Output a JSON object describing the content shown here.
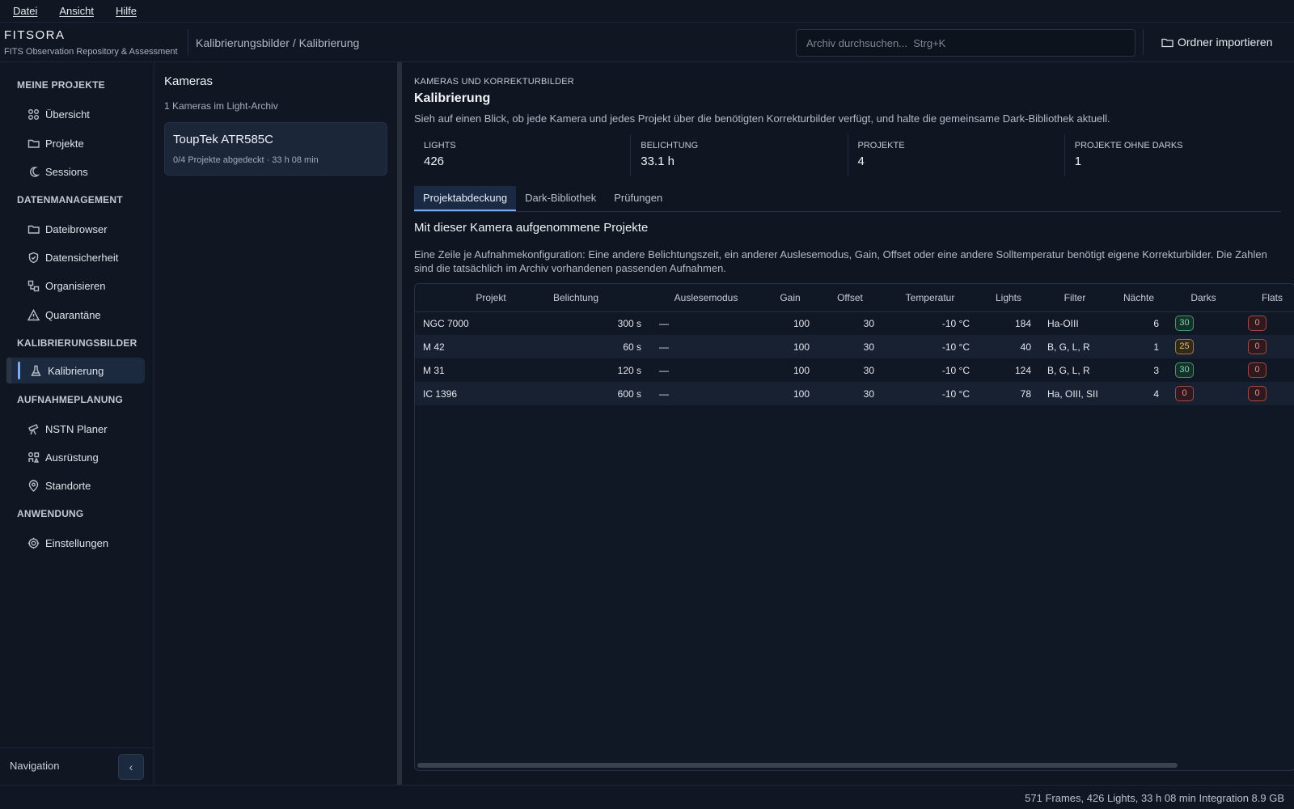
{
  "menu": [
    "Datei",
    "Ansicht",
    "Hilfe"
  ],
  "brand": {
    "title": "FITSORA",
    "subtitle": "FITS Observation Repository & Assessment"
  },
  "breadcrumb": "Kalibrierungsbilder / Kalibrierung",
  "search": {
    "placeholder": "Archiv durchsuchen...  Strg+K",
    "value": ""
  },
  "import_button": "Ordner importieren",
  "sidebar": {
    "sections": [
      {
        "title": "MEINE PROJEKTE",
        "items": [
          {
            "label": "Übersicht",
            "icon": "grid-icon"
          },
          {
            "label": "Projekte",
            "icon": "folder-icon"
          },
          {
            "label": "Sessions",
            "icon": "moon-icon"
          }
        ]
      },
      {
        "title": "DATENMANAGEMENT",
        "items": [
          {
            "label": "Dateibrowser",
            "icon": "folder-icon"
          },
          {
            "label": "Datensicherheit",
            "icon": "shield-icon"
          },
          {
            "label": "Organisieren",
            "icon": "organize-icon"
          },
          {
            "label": "Quarantäne",
            "icon": "warning-icon"
          }
        ]
      },
      {
        "title": "KALIBRIERUNGSBILDER",
        "items": [
          {
            "label": "Kalibrierung",
            "icon": "flask-icon",
            "active": true
          }
        ]
      },
      {
        "title": "AUFNAHMEPLANUNG",
        "items": [
          {
            "label": "NSTN Planer",
            "icon": "telescope-icon"
          },
          {
            "label": "Ausrüstung",
            "icon": "equipment-icon"
          },
          {
            "label": "Standorte",
            "icon": "location-icon"
          }
        ]
      },
      {
        "title": "ANWENDUNG",
        "items": [
          {
            "label": "Einstellungen",
            "icon": "settings-icon"
          }
        ]
      }
    ],
    "footer_label": "Navigation",
    "collapse_glyph": "‹"
  },
  "cameras": {
    "title": "Kameras",
    "subtitle": "1 Kameras im Light-Archiv",
    "list": [
      {
        "name": "ToupTek ATR585C",
        "meta": "0/4 Projekte abgedeckt · 33 h 08 min"
      }
    ]
  },
  "main": {
    "eyebrow": "KAMERAS UND KORREKTURBILDER",
    "title": "Kalibrierung",
    "description": "Sieh auf einen Blick, ob jede Kamera und jedes Projekt über die benötigten Korrekturbilder verfügt, und halte die gemeinsame Dark-Bibliothek aktuell.",
    "stats": [
      {
        "label": "LIGHTS",
        "value": "426"
      },
      {
        "label": "BELICHTUNG",
        "value": "33.1 h"
      },
      {
        "label": "PROJEKTE",
        "value": "4"
      },
      {
        "label": "PROJEKTE OHNE DARKS",
        "value": "1"
      }
    ],
    "tabs": [
      {
        "label": "Projektabdeckung",
        "active": true
      },
      {
        "label": "Dark-Bibliothek",
        "active": false
      },
      {
        "label": "Prüfungen",
        "active": false
      }
    ],
    "section_title": "Mit dieser Kamera aufgenommene Projekte",
    "section_desc": "Eine Zeile je Aufnahmekonfiguration: Eine andere Belichtungszeit, ein anderer Auslesemodus, Gain, Offset oder eine andere Solltemperatur benötigt eigene Korrekturbilder. Die Zahlen sind die tatsächlich im Archiv vorhandenen passenden Aufnahmen.",
    "table": {
      "columns": [
        "Projekt",
        "Belichtung",
        "Auslesemodus",
        "Gain",
        "Offset",
        "Temperatur",
        "Lights",
        "Filter",
        "Nächte",
        "Darks",
        "Flats"
      ],
      "rows": [
        {
          "projekt": "NGC 7000",
          "belichtung": "300 s",
          "modus": "—",
          "gain": "100",
          "offset": "30",
          "temp": "-10 °C",
          "lights": "184",
          "filter": "Ha-OIII",
          "naechte": "6",
          "darks": "30",
          "darks_status": "ok",
          "flats": "0",
          "flats_status": "bad"
        },
        {
          "projekt": "M 42",
          "belichtung": "60 s",
          "modus": "—",
          "gain": "100",
          "offset": "30",
          "temp": "-10 °C",
          "lights": "40",
          "filter": "B, G, L, R",
          "naechte": "1",
          "darks": "25",
          "darks_status": "warn",
          "flats": "0",
          "flats_status": "bad"
        },
        {
          "projekt": "M 31",
          "belichtung": "120 s",
          "modus": "—",
          "gain": "100",
          "offset": "30",
          "temp": "-10 °C",
          "lights": "124",
          "filter": "B, G, L, R",
          "naechte": "3",
          "darks": "30",
          "darks_status": "ok",
          "flats": "0",
          "flats_status": "bad"
        },
        {
          "projekt": "IC 1396",
          "belichtung": "600 s",
          "modus": "—",
          "gain": "100",
          "offset": "30",
          "temp": "-10 °C",
          "lights": "78",
          "filter": "Ha, OIII, SII",
          "naechte": "4",
          "darks": "0",
          "darks_status": "bad",
          "flats": "0",
          "flats_status": "bad"
        }
      ]
    }
  },
  "statusbar": "571 Frames, 426 Lights, 33 h 08 min Integration  8.9 GB"
}
